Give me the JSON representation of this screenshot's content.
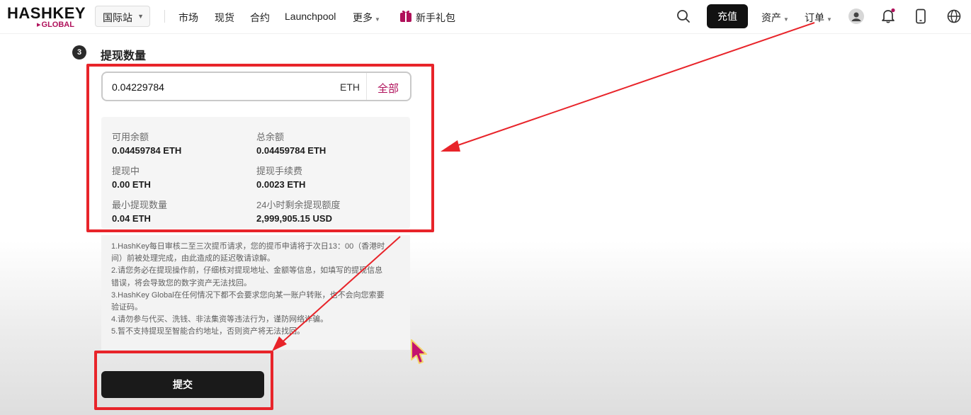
{
  "header": {
    "logo_main": "HASHKEY",
    "logo_sub": "GLOBAL",
    "site_select": "国际站",
    "nav": [
      "市场",
      "现货",
      "合约",
      "Launchpool",
      "更多"
    ],
    "gift_label": "新手礼包",
    "deposit_label": "充值",
    "assets_label": "资产",
    "orders_label": "订单",
    "brand_color": "#b0115b"
  },
  "step": {
    "number": "3",
    "title": "提现数量"
  },
  "amount": {
    "value": "0.04229784",
    "unit": "ETH",
    "all_label": "全部"
  },
  "info": [
    {
      "label": "可用余额",
      "value": "0.04459784 ETH"
    },
    {
      "label": "总余额",
      "value": "0.04459784 ETH"
    },
    {
      "label": "提现中",
      "value": "0.00 ETH"
    },
    {
      "label": "提现手续费",
      "value": "0.0023 ETH"
    },
    {
      "label": "最小提现数量",
      "value": "0.04 ETH"
    },
    {
      "label": "24小时剩余提现额度",
      "value": "2,999,905.15 USD"
    }
  ],
  "notes": [
    "1.HashKey每日审核二至三次提币请求，您的提币申请将于次日13：00（香港时",
    "间）前被处理完成，由此造成的延迟敬请谅解。",
    "2.请您务必在提现操作前，仔细核对提现地址、金额等信息，如填写的提现信息",
    "错误，将会导致您的数字资产无法找回。",
    "3.HashKey Global在任何情况下都不会要求您向某一账户转账，也不会向您索要",
    "验证码。",
    "4.请勿参与代买、洗钱、非法集资等违法行为，谨防网络诈骗。",
    "5.暂不支持提现至智能合约地址，否则资产将无法找回。"
  ],
  "submit_label": "提交",
  "annotation_color": "#e8242a",
  "icons": [
    "gift-icon",
    "search-icon",
    "bell-icon",
    "phone-icon",
    "globe-icon",
    "cursor-icon"
  ]
}
